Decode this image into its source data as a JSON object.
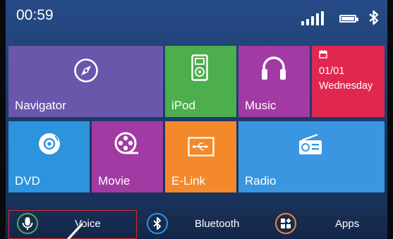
{
  "status_bar": {
    "time": "00:59",
    "icons": [
      "signal-strength-icon",
      "battery-icon",
      "bluetooth-icon"
    ]
  },
  "tiles": [
    {
      "id": "navigator",
      "label": "Navigator",
      "icon": "compass-icon",
      "color": "#6a57ac"
    },
    {
      "id": "ipod",
      "label": "iPod",
      "icon": "ipod-icon",
      "color": "#4cae4c"
    },
    {
      "id": "music",
      "label": "Music",
      "icon": "headphones-icon",
      "color": "#a23aa3"
    },
    {
      "id": "calendar",
      "date": "01/01",
      "weekday": "Wednesday",
      "icon": "calendar-icon",
      "color": "#e0284f"
    },
    {
      "id": "dvd",
      "label": "DVD",
      "icon": "disc-icon",
      "color": "#2d93dd"
    },
    {
      "id": "movie",
      "label": "Movie",
      "icon": "film-reel-icon",
      "color": "#a23aa3"
    },
    {
      "id": "elink",
      "label": "E-Link",
      "icon": "usb-icon",
      "color": "#f4892b"
    },
    {
      "id": "radio",
      "label": "Radio",
      "icon": "radio-icon",
      "color": "#3a96e0"
    }
  ],
  "dock": [
    {
      "id": "voice",
      "label": "Voice",
      "icon": "microphone-icon",
      "accent": "#4cae4c",
      "selected": true
    },
    {
      "id": "bluetooth",
      "label": "Bluetooth",
      "icon": "bluetooth-icon",
      "accent": "#2d93dd"
    },
    {
      "id": "apps",
      "label": "Apps",
      "icon": "apps-grid-icon",
      "accent": "#f4892b"
    }
  ],
  "colors": {
    "background": "#1d3a6a",
    "selection_outline": "#d42b2b"
  }
}
